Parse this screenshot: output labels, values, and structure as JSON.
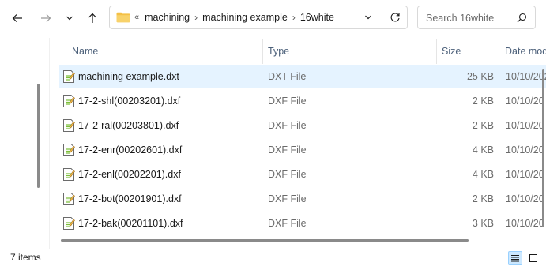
{
  "address": {
    "overflow": "«",
    "segments": [
      "machining",
      "machining example",
      "16white"
    ],
    "separator": "›"
  },
  "search": {
    "placeholder": "Search 16white"
  },
  "columns": {
    "name": "Name",
    "type": "Type",
    "size": "Size",
    "date": "Date mod"
  },
  "files": [
    {
      "name": "machining example.dxt",
      "type": "DXT File",
      "size": "25 KB",
      "date": "10/10/202",
      "selected": true
    },
    {
      "name": "17-2-shl(00203201).dxf",
      "type": "DXF File",
      "size": "2 KB",
      "date": "10/10/20"
    },
    {
      "name": "17-2-ral(00203801).dxf",
      "type": "DXF File",
      "size": "2 KB",
      "date": "10/10/20"
    },
    {
      "name": "17-2-enr(00202601).dxf",
      "type": "DXF File",
      "size": "4 KB",
      "date": "10/10/20"
    },
    {
      "name": "17-2-enl(00202201).dxf",
      "type": "DXF File",
      "size": "4 KB",
      "date": "10/10/20"
    },
    {
      "name": "17-2-bot(00201901).dxf",
      "type": "DXF File",
      "size": "2 KB",
      "date": "10/10/20"
    },
    {
      "name": "17-2-bak(00201101).dxf",
      "type": "DXF File",
      "size": "3 KB",
      "date": "10/10/20"
    }
  ],
  "status": {
    "item_count": "7 items",
    "view": "details"
  },
  "icons": {
    "back": "arrow-left-icon",
    "forward": "arrow-right-icon",
    "recent": "chevron-down-icon",
    "up": "arrow-up-icon",
    "folder": "folder-icon",
    "refresh": "refresh-icon",
    "search": "search-icon",
    "file": "document-icon",
    "details_view": "details-view-icon",
    "tiles_view": "large-icons-view-icon"
  },
  "colors": {
    "selected_row": "#e5f3ff",
    "header_text": "#4c607a",
    "folder": "#f4c046"
  }
}
